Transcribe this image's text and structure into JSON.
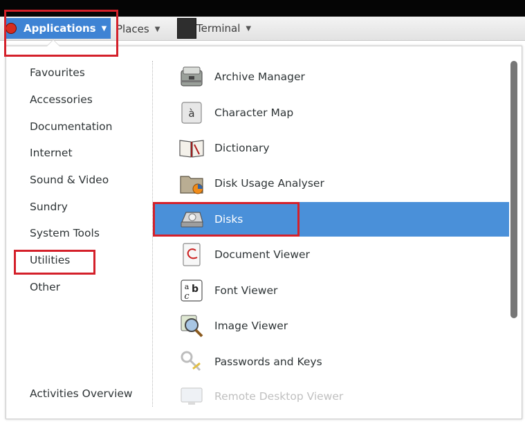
{
  "panel": {
    "applications_label": "Applications",
    "places_label": "Places",
    "terminal_label": "Terminal",
    "dropdown_caret": "▼"
  },
  "categories": [
    {
      "label": "Favourites"
    },
    {
      "label": "Accessories"
    },
    {
      "label": "Documentation"
    },
    {
      "label": "Internet"
    },
    {
      "label": "Sound & Video"
    },
    {
      "label": "Sundry"
    },
    {
      "label": "System Tools"
    },
    {
      "label": "Utilities"
    },
    {
      "label": "Other"
    }
  ],
  "activities_overview_label": "Activities Overview",
  "apps": [
    {
      "label": "Archive Manager",
      "icon": "archive-icon"
    },
    {
      "label": "Character Map",
      "icon": "character-map-icon",
      "glyph": "à"
    },
    {
      "label": "Dictionary",
      "icon": "dictionary-icon"
    },
    {
      "label": "Disk Usage Analyser",
      "icon": "disk-usage-icon"
    },
    {
      "label": "Disks",
      "icon": "disks-icon",
      "selected": true
    },
    {
      "label": "Document Viewer",
      "icon": "document-viewer-icon"
    },
    {
      "label": "Font Viewer",
      "icon": "font-viewer-icon",
      "glyph_top": "a",
      "glyph_b": "b",
      "glyph_c": "c"
    },
    {
      "label": "Image Viewer",
      "icon": "image-viewer-icon"
    },
    {
      "label": "Passwords and Keys",
      "icon": "keys-icon"
    },
    {
      "label": "Remote Desktop Viewer",
      "icon": "remote-desktop-icon"
    }
  ],
  "colors": {
    "selection": "#4a90d9",
    "highlight_box": "#d4202a",
    "panel_active": "#3e83d4"
  }
}
